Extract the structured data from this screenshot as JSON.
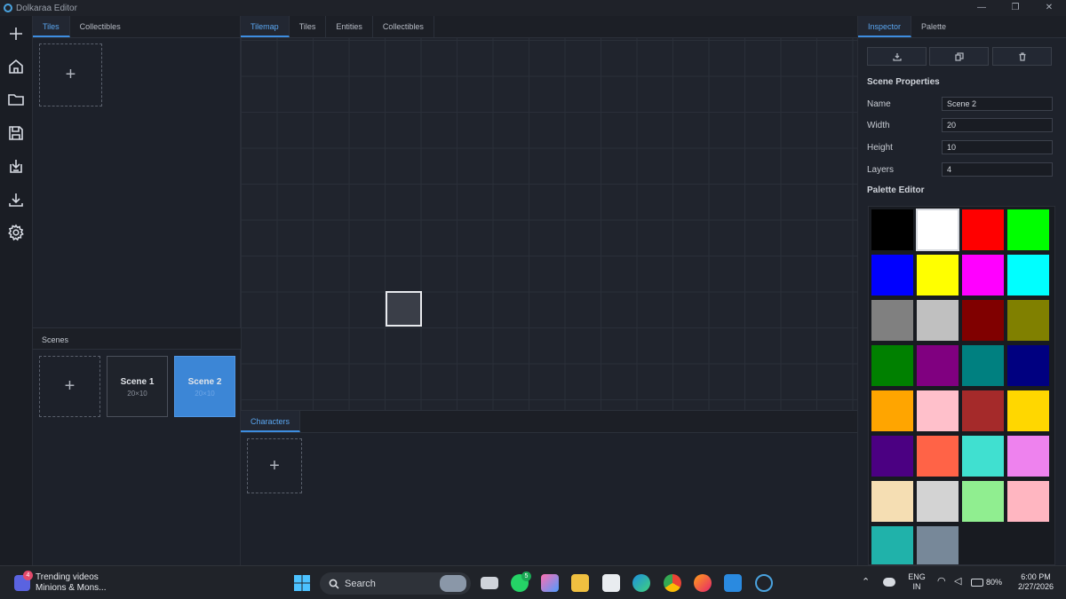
{
  "window": {
    "title": "Dolkaraa Editor",
    "controls": [
      "—",
      "❐",
      "✕"
    ]
  },
  "sidebar_icons": [
    "plus-icon",
    "home-icon",
    "folder-icon",
    "save-icon",
    "import-icon",
    "download-icon",
    "gear-icon"
  ],
  "left_panel": {
    "tabs": [
      {
        "label": "Tiles"
      },
      {
        "label": "Collectibles"
      }
    ],
    "add_symbol": "+",
    "scenes_title": "Scenes",
    "scenes": [
      {
        "name": "Scene 1",
        "size": "20×10"
      },
      {
        "name": "Scene 2",
        "size": "20×10"
      }
    ]
  },
  "center": {
    "tabs": [
      {
        "label": "Tilemap"
      },
      {
        "label": "Tiles"
      },
      {
        "label": "Entities"
      },
      {
        "label": "Collectibles"
      }
    ],
    "bottom_tabs": [
      {
        "label": "Characters"
      }
    ]
  },
  "inspector": {
    "tabs": [
      {
        "label": "Inspector"
      },
      {
        "label": "Palette"
      }
    ],
    "tool_buttons": [
      "download-icon",
      "copy-icon",
      "trash-icon"
    ],
    "scene_properties_title": "Scene Properties",
    "props": [
      {
        "label": "Name",
        "value": "Scene 2"
      },
      {
        "label": "Width",
        "value": "20"
      },
      {
        "label": "Height",
        "value": "10"
      },
      {
        "label": "Layers",
        "value": "4"
      }
    ],
    "palette_title": "Palette Editor",
    "palette_colors": [
      "#000000",
      "#ffffff",
      "#ff0000",
      "#00ff00",
      "#0000ff",
      "#ffff00",
      "#ff00ff",
      "#00ffff",
      "#808080",
      "#c0c0c0",
      "#800000",
      "#808000",
      "#008000",
      "#800080",
      "#008080",
      "#000080",
      "#ffa500",
      "#ffc0cb",
      "#a52a2a",
      "#ffd700",
      "#4b0082",
      "#ff6347",
      "#40e0d0",
      "#ee82ee",
      "#f5deb3",
      "#d3d3d3",
      "#90ee90",
      "#ffb6c1",
      "#20b2aa",
      "#778899"
    ]
  },
  "taskbar": {
    "widget_title": "Trending videos",
    "widget_sub": "Minions & Mons...",
    "widget_badge": "4",
    "search_label": "Search",
    "whatsapp_badge": "5",
    "lang_line1": "ENG",
    "lang_line2": "IN",
    "battery": "80%",
    "time": "6:00 PM",
    "date": "2/27/2026"
  }
}
